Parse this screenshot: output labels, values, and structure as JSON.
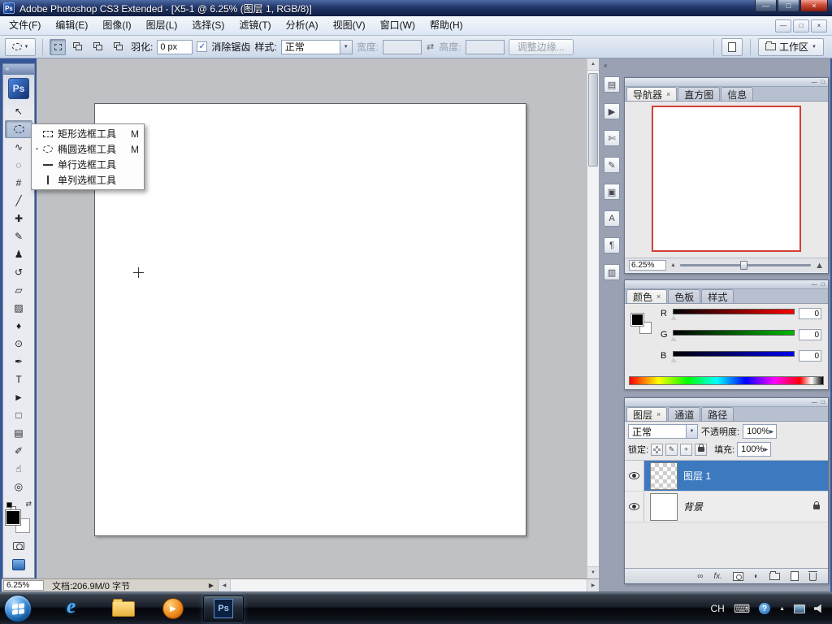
{
  "colors": {
    "selected_layer": "#3c79bf",
    "navigator_proxy_border": "#d43f35",
    "foreground_color": "#000000",
    "background_color": "#ffffff"
  },
  "icons": {
    "minimize": "—",
    "maximize": "□",
    "close": "×",
    "tab_close": "×",
    "arrow_down": "▼",
    "arrow_up": "▲",
    "arrow_right": "▶",
    "arrow_left": "◀",
    "swap": "⇄",
    "collapse": "«",
    "check": "✓",
    "bullet": "▪",
    "link": "∞",
    "fx": "fx.",
    "adjustment": "◐",
    "brush": "✎",
    "move_cross": "+",
    "help": "?",
    "play": "▶",
    "ie": "e",
    "keyboard": "⌨"
  },
  "window": {
    "app_badge": "Ps",
    "title": "Adobe Photoshop CS3 Extended - [X5-1 @ 6.25% (图层 1, RGB/8)]"
  },
  "menubar": {
    "items": [
      "文件(F)",
      "编辑(E)",
      "图像(I)",
      "图层(L)",
      "选择(S)",
      "滤镜(T)",
      "分析(A)",
      "视图(V)",
      "窗口(W)",
      "帮助(H)"
    ]
  },
  "optionsbar": {
    "feather_label": "羽化:",
    "feather_value": "0 px",
    "antialias_label": "消除锯齿",
    "antialias_checked": true,
    "style_label": "样式:",
    "style_value": "正常",
    "width_label": "宽度:",
    "width_value": "",
    "height_label": "高度:",
    "height_value": "",
    "refine_edge_label": "调整边缘...",
    "workspace_label": "工作区"
  },
  "toolbox": {
    "logo": "Ps",
    "tools": [
      {
        "name": "移动工具",
        "glyph": "↖"
      },
      {
        "name": "椭圆选框工具",
        "glyph": "◯",
        "active": true
      },
      {
        "name": "套索工具",
        "glyph": "∿"
      },
      {
        "name": "快速选择工具",
        "glyph": "◌"
      },
      {
        "name": "裁剪工具",
        "glyph": "#"
      },
      {
        "name": "切片工具",
        "glyph": "╱"
      },
      {
        "name": "污点修复画笔工具",
        "glyph": "✚"
      },
      {
        "name": "画笔工具",
        "glyph": "✎"
      },
      {
        "name": "仿制图章工具",
        "glyph": "♟"
      },
      {
        "name": "历史记录画笔工具",
        "glyph": "↺"
      },
      {
        "name": "橡皮擦工具",
        "glyph": "▱"
      },
      {
        "name": "渐变工具",
        "glyph": "▨"
      },
      {
        "name": "模糊工具",
        "glyph": "♦"
      },
      {
        "name": "减淡工具",
        "glyph": "⊙"
      },
      {
        "name": "钢笔工具",
        "glyph": "✒"
      },
      {
        "name": "横排文字工具",
        "glyph": "T"
      },
      {
        "name": "路径选择工具",
        "glyph": "►"
      },
      {
        "name": "矩形工具",
        "glyph": "□"
      },
      {
        "name": "注释工具",
        "glyph": "▤"
      },
      {
        "name": "吸管工具",
        "glyph": "✐"
      },
      {
        "name": "抓手工具",
        "glyph": "☝"
      },
      {
        "name": "缩放工具",
        "glyph": "◎"
      }
    ]
  },
  "flyout": {
    "items": [
      {
        "label": "矩形选框工具",
        "shortcut": "M",
        "selected": false
      },
      {
        "label": "椭圆选框工具",
        "shortcut": "M",
        "selected": true
      },
      {
        "label": "单行选框工具",
        "shortcut": "",
        "selected": false
      },
      {
        "label": "单列选框工具",
        "shortcut": "",
        "selected": false
      }
    ]
  },
  "statusbar": {
    "zoom": "6.25%",
    "doc_info": "文档:206.9M/0 字节"
  },
  "dock_icons": [
    {
      "name": "layer-comps-panel",
      "glyph": "▤"
    },
    {
      "name": "actions-panel",
      "glyph": "▶"
    },
    {
      "name": "tool-presets-panel",
      "glyph": "✄"
    },
    {
      "name": "brushes-panel",
      "glyph": "✎"
    },
    {
      "name": "clone-source-panel",
      "glyph": "▣"
    },
    {
      "name": "character-panel",
      "glyph": "A"
    },
    {
      "name": "paragraph-panel",
      "glyph": "¶"
    },
    {
      "name": "histogram-panel",
      "glyph": "▥"
    }
  ],
  "navigator": {
    "tabs": [
      "导航器",
      "直方图",
      "信息"
    ],
    "zoom": "6.25%"
  },
  "color": {
    "tabs": [
      "颜色",
      "色板",
      "样式"
    ],
    "channels": [
      {
        "label": "R",
        "value": "0"
      },
      {
        "label": "G",
        "value": "0"
      },
      {
        "label": "B",
        "value": "0"
      }
    ]
  },
  "layers": {
    "tabs": [
      "图层",
      "通道",
      "路径"
    ],
    "blend_mode": "正常",
    "opacity_label": "不透明度:",
    "opacity_value": "100%",
    "lock_label": "锁定:",
    "fill_label": "填充:",
    "fill_value": "100%",
    "items": [
      {
        "name": "图层 1",
        "selected": true,
        "thumbnail": "transparent-checker"
      },
      {
        "name": "背景",
        "selected": false,
        "locked": true,
        "thumbnail": "white"
      }
    ]
  },
  "taskbar": {
    "ps_badge": "Ps",
    "tray_lang": "CH"
  }
}
